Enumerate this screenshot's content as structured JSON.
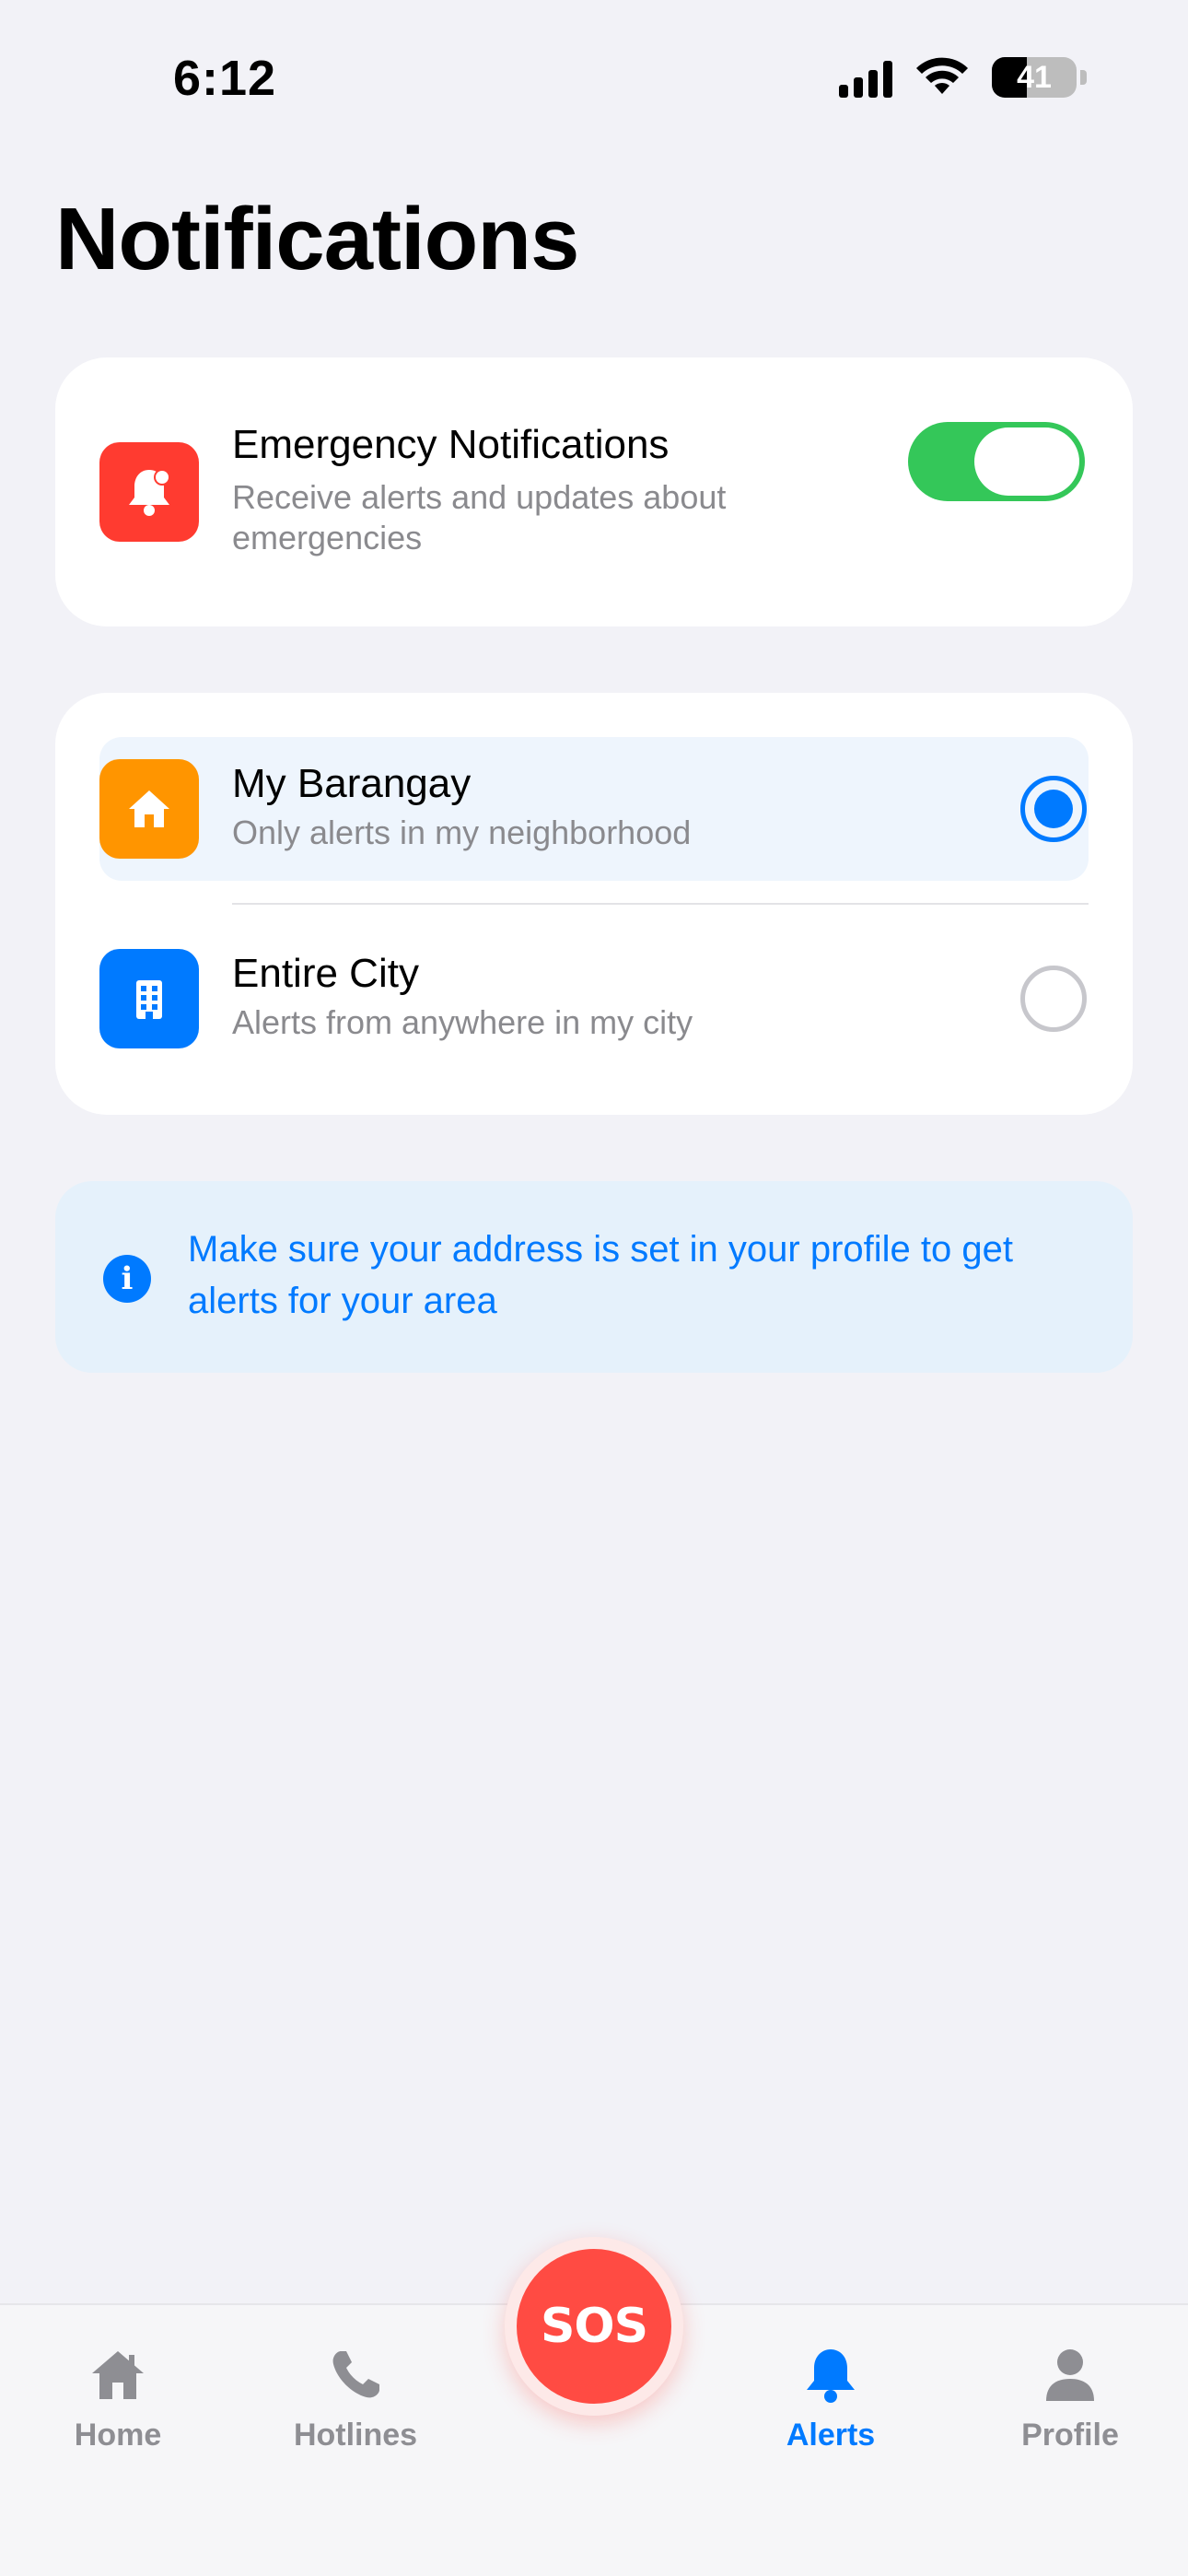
{
  "status_bar": {
    "time": "6:12",
    "battery": "41"
  },
  "page": {
    "title": "Notifications"
  },
  "emergency": {
    "title": "Emergency Notifications",
    "subtitle": "Receive alerts and updates about emergencies",
    "enabled": true,
    "icon": "bell-badge-icon",
    "icon_color": "#ff3b30"
  },
  "scope": {
    "options": [
      {
        "title": "My Barangay",
        "subtitle": "Only alerts in my neighborhood",
        "icon": "house-icon",
        "icon_color": "#ff9500",
        "selected": true
      },
      {
        "title": "Entire City",
        "subtitle": "Alerts from anywhere in my city",
        "icon": "building-icon",
        "icon_color": "#007aff",
        "selected": false
      }
    ]
  },
  "info": {
    "text": "Make sure your address is set in your profile to get alerts for your area",
    "icon": "info-icon"
  },
  "tab_bar": {
    "tabs": [
      {
        "label": "Home",
        "icon": "home-icon",
        "active": false
      },
      {
        "label": "Hotlines",
        "icon": "phone-icon",
        "active": false
      },
      {
        "label": "Alerts",
        "icon": "bell-icon",
        "active": true
      },
      {
        "label": "Profile",
        "icon": "person-icon",
        "active": false
      }
    ],
    "sos_label": "SOS"
  },
  "colors": {
    "accent": "#007aff",
    "toggle_on": "#34c759",
    "sos": "#ff4b43",
    "background": "#f2f2f7"
  }
}
